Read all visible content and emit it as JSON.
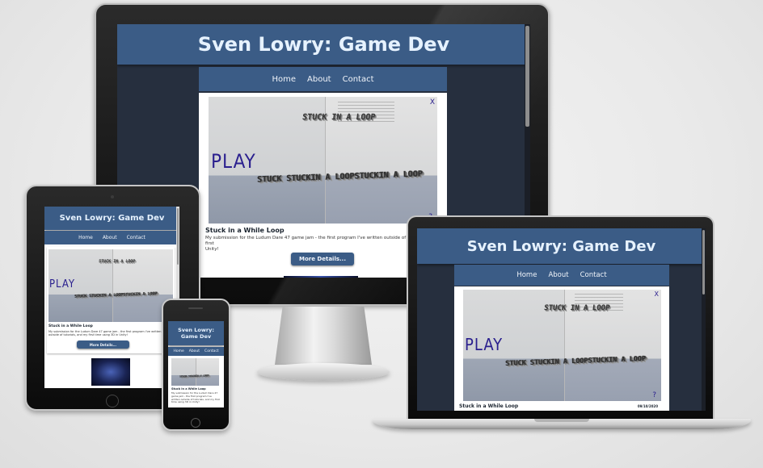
{
  "site": {
    "title": "Sven Lowry: Game Dev",
    "nav": [
      "Home",
      "About",
      "Contact"
    ],
    "post": {
      "title": "Stuck in a While Loop",
      "excerpt": "My submission for the Ludum Dare 47 game jam - the first program I've written outside of tutorials, and my first time using 3D in Unity!",
      "excerpt_short": "My submission for the Ludum Dare 47 game jam - the first program I've written outside of tutorials, and my first",
      "excerpt_cut": "Unity!",
      "button": "More Details...",
      "date": "09/10/2020"
    },
    "game": {
      "play": "PLAY",
      "stuck": "STUCK IN A LOOP",
      "close": "X",
      "help": "?"
    }
  },
  "devices": [
    "desktop-monitor",
    "laptop",
    "tablet",
    "phone"
  ]
}
